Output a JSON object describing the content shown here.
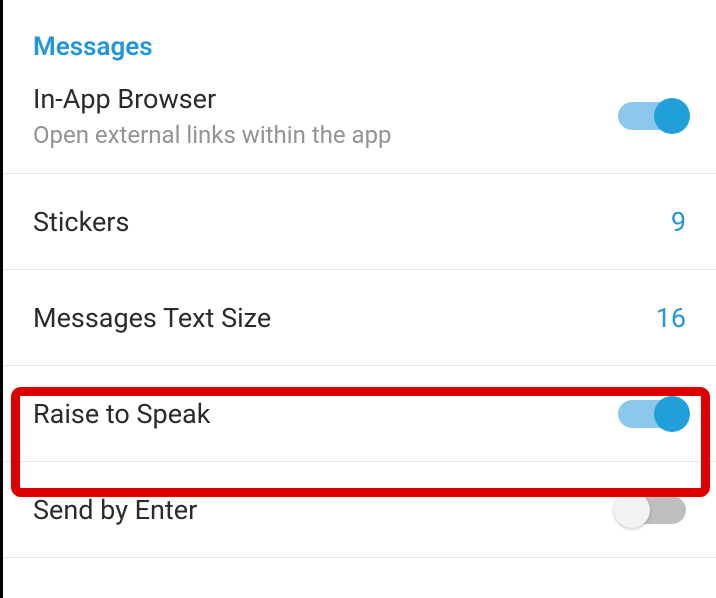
{
  "section": {
    "header": "Messages"
  },
  "settings": {
    "inAppBrowser": {
      "title": "In-App Browser",
      "subtitle": "Open external links within the app",
      "enabled": true
    },
    "stickers": {
      "title": "Stickers",
      "value": "9"
    },
    "messagesTextSize": {
      "title": "Messages Text Size",
      "value": "16"
    },
    "raiseToSpeak": {
      "title": "Raise to Speak",
      "enabled": true
    },
    "sendByEnter": {
      "title": "Send by Enter",
      "enabled": false
    }
  }
}
